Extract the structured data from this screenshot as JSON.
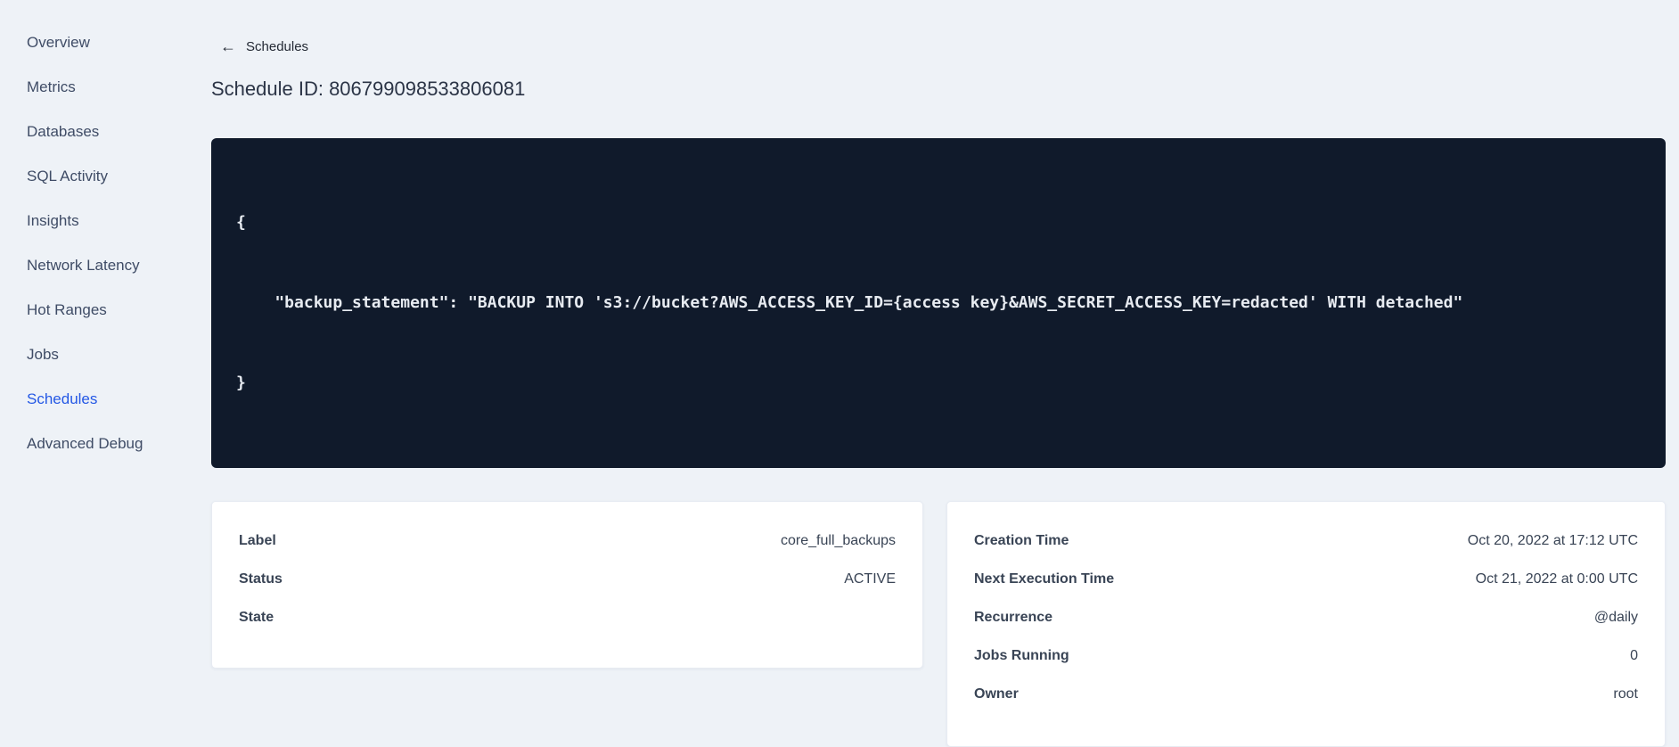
{
  "colors": {
    "background": "#eef2f7",
    "card_background": "#ffffff",
    "code_background": "#101a2b",
    "code_text": "#e7ebf1",
    "accent_blue": "#2458e5",
    "nav_text": "#3f4c66",
    "text_primary": "#242a35"
  },
  "sidebar": {
    "items": [
      {
        "label": "Overview",
        "active": false
      },
      {
        "label": "Metrics",
        "active": false
      },
      {
        "label": "Databases",
        "active": false
      },
      {
        "label": "SQL Activity",
        "active": false
      },
      {
        "label": "Insights",
        "active": false
      },
      {
        "label": "Network Latency",
        "active": false
      },
      {
        "label": "Hot Ranges",
        "active": false
      },
      {
        "label": "Jobs",
        "active": false
      },
      {
        "label": "Schedules",
        "active": true
      },
      {
        "label": "Advanced Debug",
        "active": false
      }
    ]
  },
  "header": {
    "back_icon": "←",
    "back_label": "Schedules",
    "title": "Schedule ID: 806799098533806081"
  },
  "code_block": {
    "lines": [
      "{",
      "    \"backup_statement\": \"BACKUP INTO 's3://bucket?AWS_ACCESS_KEY_ID={access key}&AWS_SECRET_ACCESS_KEY=redacted' WITH detached\"",
      "}"
    ]
  },
  "details_card": {
    "rows": [
      {
        "label": "Label",
        "value": "core_full_backups"
      },
      {
        "label": "Status",
        "value": "ACTIVE"
      },
      {
        "label": "State",
        "value": ""
      }
    ]
  },
  "meta_card": {
    "rows": [
      {
        "label": "Creation Time",
        "value": "Oct 20, 2022 at 17:12 UTC"
      },
      {
        "label": "Next Execution Time",
        "value": "Oct 21, 2022 at 0:00 UTC"
      },
      {
        "label": "Recurrence",
        "value": "@daily"
      },
      {
        "label": "Jobs Running",
        "value": "0"
      },
      {
        "label": "Owner",
        "value": "root"
      }
    ]
  }
}
